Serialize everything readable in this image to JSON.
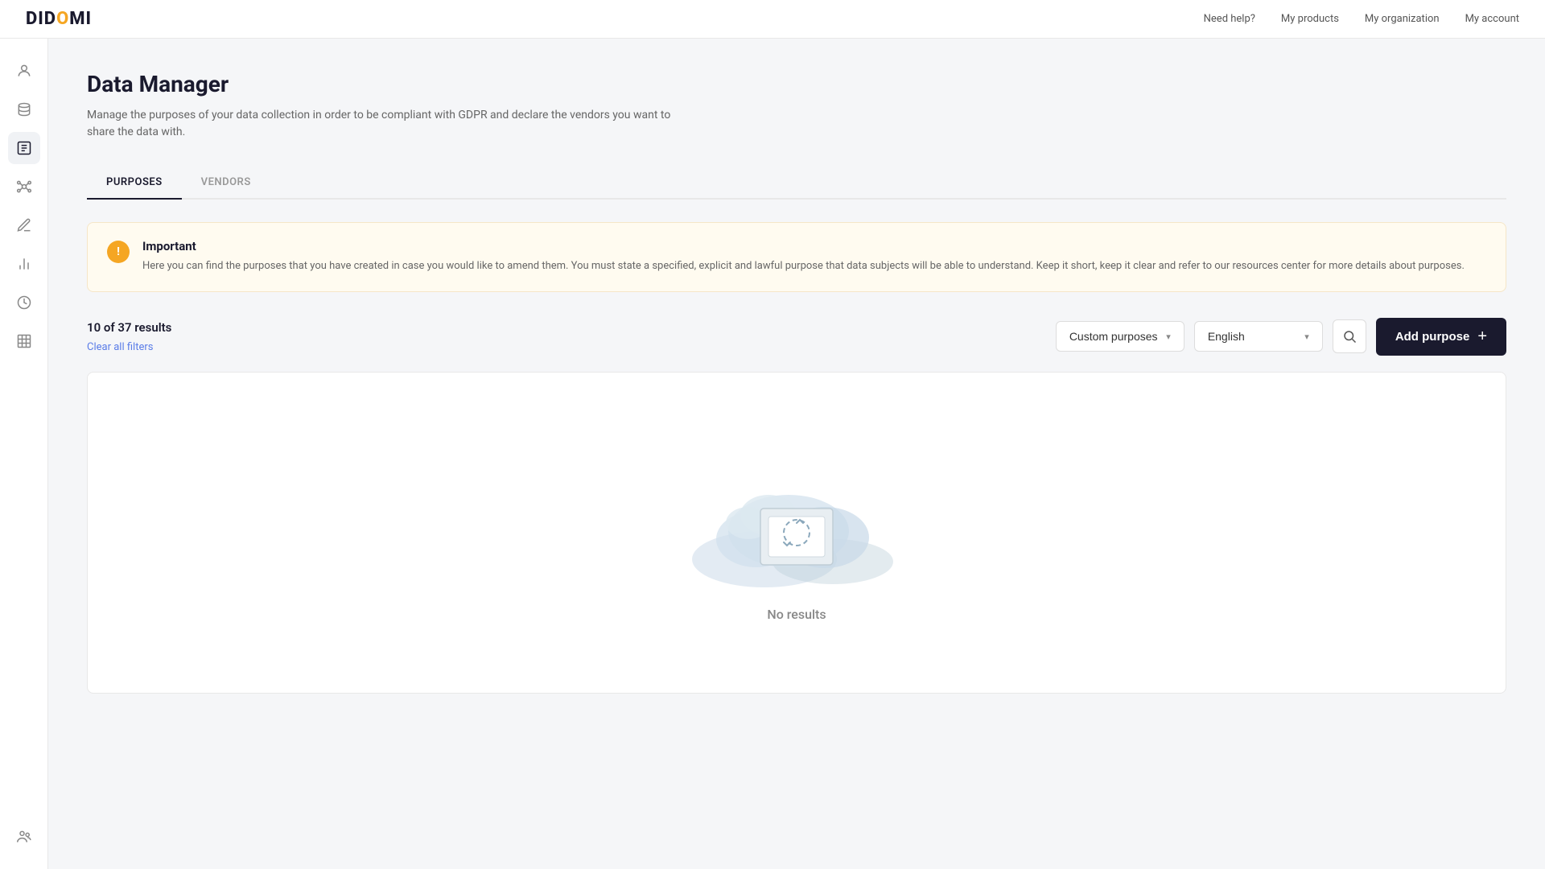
{
  "topnav": {
    "logo": "DIDOMI",
    "links": [
      {
        "label": "Need help?",
        "id": "need-help"
      },
      {
        "label": "My products",
        "id": "my-products"
      },
      {
        "label": "My organization",
        "id": "my-organization"
      },
      {
        "label": "My account",
        "id": "my-account"
      }
    ]
  },
  "sidebar": {
    "icons": [
      {
        "id": "user-icon",
        "symbol": "👤"
      },
      {
        "id": "database-icon",
        "symbol": "🗄"
      },
      {
        "id": "list-icon",
        "symbol": "📋"
      },
      {
        "id": "network-icon",
        "symbol": "🔗"
      },
      {
        "id": "edit-icon",
        "symbol": "✏️"
      },
      {
        "id": "chart-icon",
        "symbol": "📊"
      },
      {
        "id": "clock-icon",
        "symbol": "🕐"
      },
      {
        "id": "building-icon",
        "symbol": "🏢"
      },
      {
        "id": "group-icon",
        "symbol": "👥"
      }
    ]
  },
  "page": {
    "title": "Data Manager",
    "subtitle": "Manage the purposes of your data collection in order to be compliant with GDPR and declare the vendors you want to share the data with."
  },
  "tabs": [
    {
      "id": "purposes",
      "label": "PURPOSES",
      "active": true
    },
    {
      "id": "vendors",
      "label": "VENDORS",
      "active": false
    }
  ],
  "alert": {
    "title": "Important",
    "text": "Here you can find the purposes that you have created in case you would like to amend them. You must state a specified, explicit and lawful purpose that data subjects will be able to understand. Keep it short, keep it clear and refer to our resources center for more details about purposes."
  },
  "toolbar": {
    "results_count": "10 of 37 results",
    "clear_filters": "Clear all filters",
    "filter_custom_purposes": "Custom purposes",
    "filter_language": "English",
    "add_purpose_label": "Add purpose"
  },
  "empty_state": {
    "text": "No results"
  }
}
